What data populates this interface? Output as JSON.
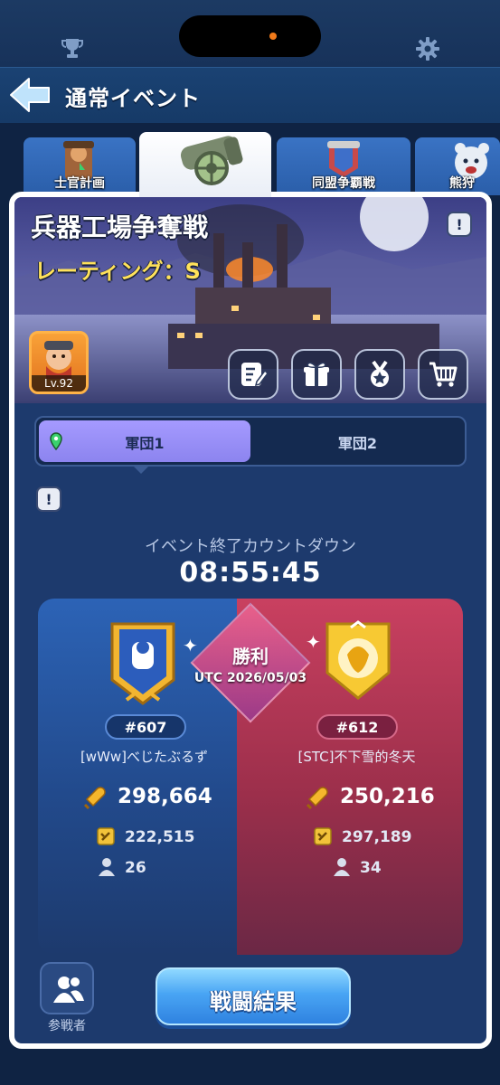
{
  "header": {
    "title": "通常イベント"
  },
  "tabs": [
    {
      "label": "士官計画",
      "active": false
    },
    {
      "label": "",
      "active": true
    },
    {
      "label": "同盟争覇戦",
      "active": false
    },
    {
      "label": "熊狩",
      "active": false
    }
  ],
  "event": {
    "title": "兵器工場争奪戦",
    "rating": "レーティング：S",
    "player_level": "Lv.92"
  },
  "legions": {
    "active": "軍団1",
    "inactive": "軍団2"
  },
  "countdown": {
    "label": "イベント終了カウントダウン",
    "time": "08:55:45"
  },
  "result": {
    "label": "勝利",
    "date": "UTC 2026/05/03"
  },
  "left_team": {
    "rank": "#607",
    "name": "[wWw]べじたぶるず",
    "bullets": "298,664",
    "power": "222,515",
    "members": "26"
  },
  "right_team": {
    "rank": "#612",
    "name": "[STC]不下雪的冬天",
    "bullets": "250,216",
    "power": "297,189",
    "members": "34"
  },
  "footer": {
    "participants_label": "参戦者",
    "battle_result_label": "戦闘結果"
  },
  "colors": {
    "accent_blue": "#2c63b6",
    "accent_red": "#c94060",
    "rating_yellow": "#ffe25a",
    "active_segment": "#a59aff"
  }
}
